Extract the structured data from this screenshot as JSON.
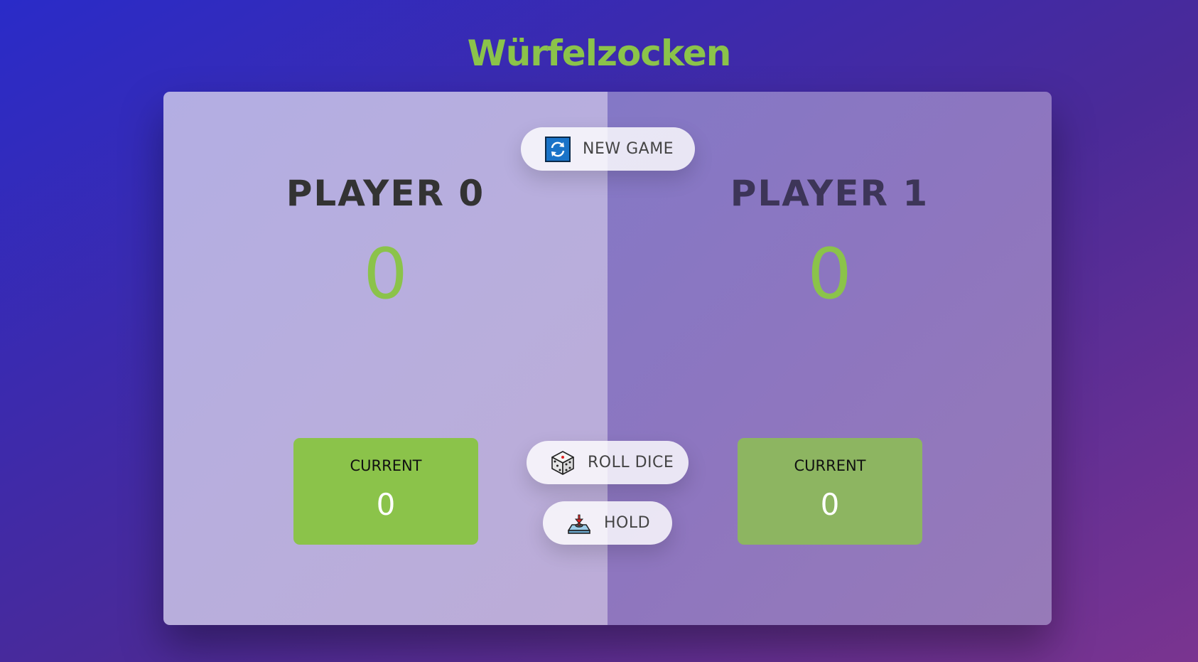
{
  "app": {
    "title": "Würfelzocken"
  },
  "players": [
    {
      "name": "PLAYER 0",
      "score": "0",
      "current_label": "CURRENT",
      "current_score": "0",
      "active": true
    },
    {
      "name": "PLAYER 1",
      "score": "0",
      "current_label": "CURRENT",
      "current_score": "0",
      "active": false
    }
  ],
  "controls": {
    "new_game": {
      "label": "NEW GAME",
      "icon": "refresh-icon"
    },
    "roll_dice": {
      "label": "ROLL DICE",
      "icon": "dice-icon"
    },
    "hold": {
      "label": "HOLD",
      "icon": "joystick-icon"
    }
  },
  "colors": {
    "accent": "#8bc34a",
    "background_start": "#2a2bc8",
    "background_end": "#7a3490"
  }
}
